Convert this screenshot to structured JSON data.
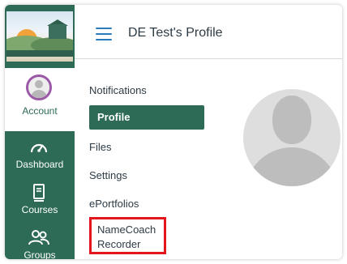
{
  "colors": {
    "nav_green": "#2d6b56",
    "active_item": "#2d6b56",
    "avatar_ring": "#9b59a8",
    "hamburger": "#2b7abc",
    "highlight_box": "#e3161d"
  },
  "global_nav": {
    "logo_icon": "college-logo",
    "items": [
      {
        "label": "Account",
        "icon": "user-avatar-icon",
        "active": true
      },
      {
        "label": "Dashboard",
        "icon": "speedometer-icon"
      },
      {
        "label": "Courses",
        "icon": "book-icon"
      },
      {
        "label": "Groups",
        "icon": "people-icon"
      }
    ]
  },
  "header": {
    "title": "DE Test's Profile",
    "menu_icon": "hamburger-icon"
  },
  "section_nav": {
    "items": [
      {
        "label": "Notifications"
      },
      {
        "label": "Profile",
        "active": true
      },
      {
        "label": "Files"
      },
      {
        "label": "Settings"
      },
      {
        "label": "ePortfolios"
      },
      {
        "label": "NameCoach Recorder",
        "highlighted": true
      }
    ]
  },
  "profile": {
    "avatar_icon": "profile-placeholder-avatar"
  }
}
